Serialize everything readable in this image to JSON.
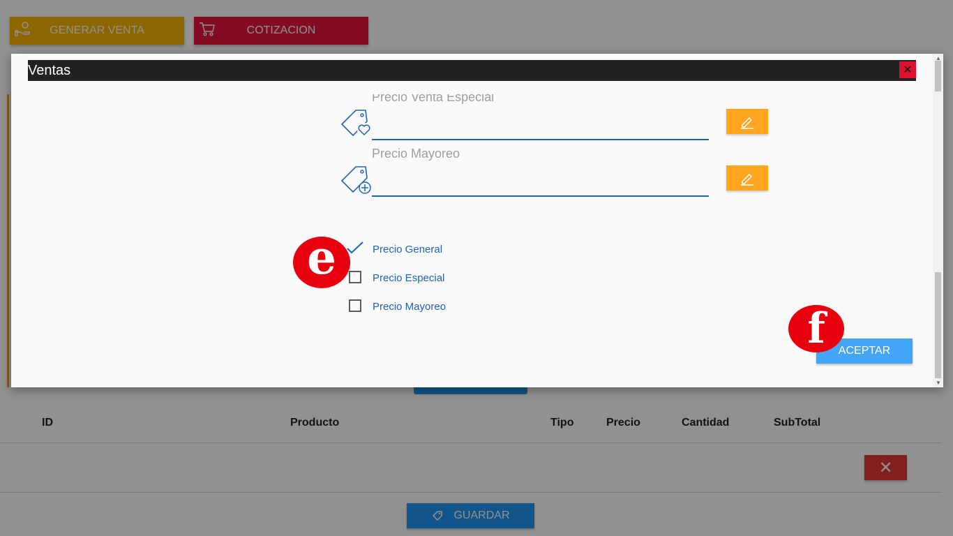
{
  "top_actions": {
    "generar_label": "GENERAR VENTA",
    "cotizacion_label": "COTIZACION"
  },
  "table": {
    "headers": [
      "ID",
      "Producto",
      "Tipo",
      "Precio",
      "Cantidad",
      "SubTotal"
    ],
    "delete_label": "✕"
  },
  "guardar_label": "GUARDAR",
  "modal": {
    "title": "Ventas",
    "close_label": "✕",
    "fields": [
      {
        "label": "Precio Venta Especial",
        "value": ""
      },
      {
        "label": "Precio Mayoreo",
        "value": ""
      }
    ],
    "options": [
      {
        "label": "Precio General",
        "checked": true
      },
      {
        "label": "Precio Especial",
        "checked": false
      },
      {
        "label": "Precio Mayoreo",
        "checked": false
      }
    ],
    "aceptar_label": "ACEPTAR"
  },
  "annotations": {
    "badge_e": "e",
    "badge_f": "f"
  },
  "colors": {
    "generar": "#f7b500",
    "cotizacion": "#e8163c",
    "title_bar": "#222222",
    "edit_button": "#ffa51f",
    "accent_blue": "#1e62b5",
    "aceptar": "#42a5f5",
    "badge": "#e8000f"
  },
  "icons": [
    "hand-money-icon",
    "cart-icon",
    "tag-heart-icon",
    "tag-plus-icon",
    "pencil-icon",
    "check-icon",
    "tag-icon"
  ]
}
